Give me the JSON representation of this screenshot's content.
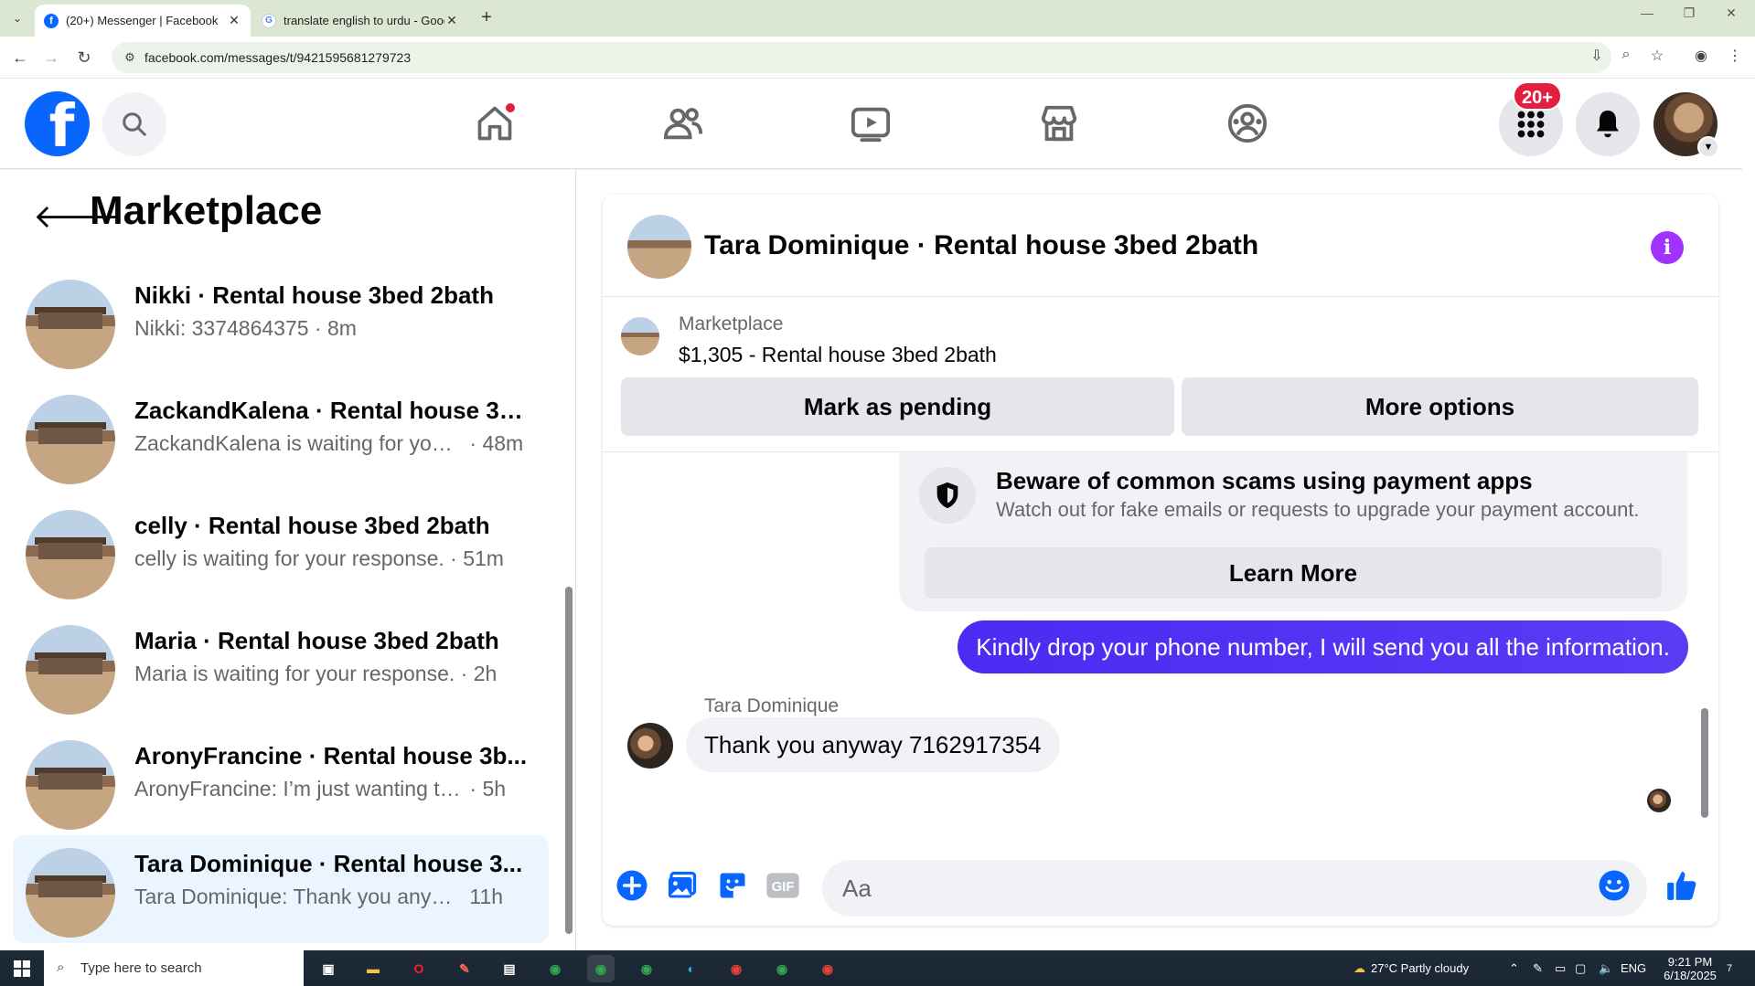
{
  "browser": {
    "tabs": [
      {
        "title": "(20+) Messenger | Facebook",
        "active": true
      },
      {
        "title": "translate english to urdu - Goog",
        "active": false
      }
    ],
    "url": "facebook.com/messages/t/9421595681279723"
  },
  "fb_nav": {
    "notifications_badge": "20+",
    "items": [
      "home",
      "friends",
      "watch",
      "marketplace",
      "groups"
    ]
  },
  "sidebar": {
    "title": "Marketplace",
    "conversations": [
      {
        "name": "Nikki · Rental house 3bed 2bath",
        "preview": "Nikki: 3374864375",
        "time": "· 8m",
        "selected": false
      },
      {
        "name": "ZackandKalena · Rental house 3b...",
        "preview": "ZackandKalena is waiting for your ...",
        "time": "· 48m",
        "selected": false
      },
      {
        "name": "celly · Rental house 3bed 2bath",
        "preview": "celly is waiting for your response.",
        "time": "· 51m",
        "selected": false
      },
      {
        "name": "Maria · Rental house 3bed 2bath",
        "preview": "Maria is waiting for your response.",
        "time": "· 2h",
        "selected": false
      },
      {
        "name": "AronyFrancine · Rental house 3b...",
        "preview": "AronyFrancine: I’m just wanting to k...",
        "time": "· 5h",
        "selected": false
      },
      {
        "name": "Tara Dominique · Rental house 3...",
        "preview": "Tara Dominique: Thank you anyway...",
        "time": "11h",
        "selected": true
      }
    ]
  },
  "chat": {
    "title": "Tara Dominique · Rental house 3bed 2bath",
    "marketplace_label": "Marketplace",
    "listing": "$1,305 - Rental house 3bed 2bath",
    "mark_pending": "Mark as pending",
    "more_options": "More options",
    "scam_title": "Beware of common scams using payment apps",
    "scam_sub": "Watch out for fake emails or requests to upgrade your payment account.",
    "learn_more": "Learn More",
    "outgoing_message": "Kindly drop your phone number, I will send you all the information.",
    "sender_name": "Tara Dominique",
    "incoming_message": "Thank you anyway 7162917354",
    "input_placeholder": "Aa"
  },
  "taskbar": {
    "search_placeholder": "Type here to search",
    "weather": "27°C  Partly cloudy",
    "language": "ENG",
    "time": "9:21 PM",
    "date": "6/18/2025",
    "notification_count": "7"
  },
  "colors": {
    "fb_blue": "#0866ff",
    "messenger_purple": "#5a3cf5",
    "badge_red": "#e41e3f",
    "info_purple": "#a033ff"
  }
}
